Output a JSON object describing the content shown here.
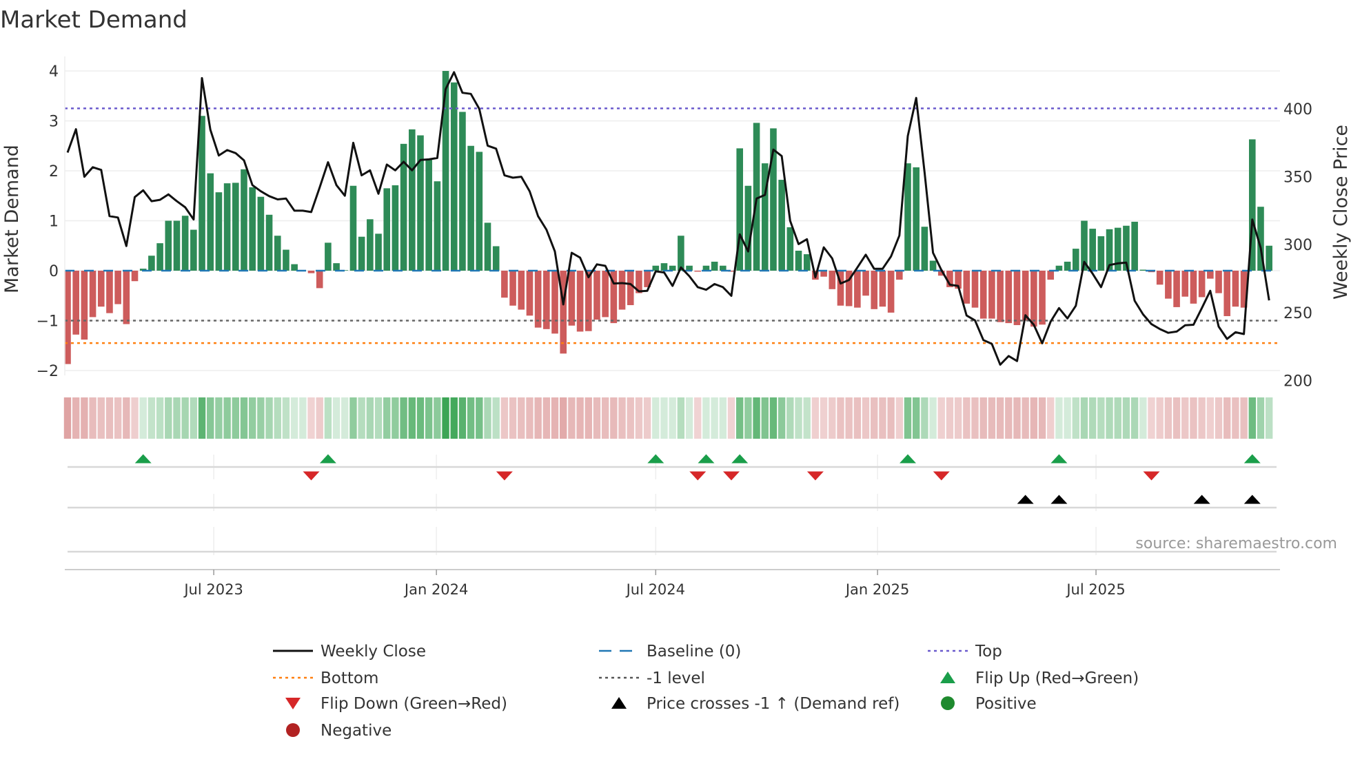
{
  "chart_data": {
    "type": "bar",
    "title": "Market Demand",
    "ylabel": "Market Demand",
    "y2label": "Weekly Close Price",
    "ylim": [
      -2.2,
      4.3
    ],
    "y2lim": [
      195,
      430
    ],
    "yticks": [
      -2,
      -1,
      0,
      1,
      2,
      3,
      4
    ],
    "y2ticks": [
      200,
      250,
      300,
      350,
      400
    ],
    "xticks": [
      "Jul 2023",
      "Jan 2024",
      "Jul 2024",
      "Jan 2025",
      "Jul 2025"
    ],
    "xtick_week_index": [
      17.4,
      43.9,
      70,
      96.4,
      122.4
    ],
    "grid": true,
    "levels": {
      "top": 3.25,
      "baseline": 0,
      "minus_one": -1,
      "bottom": -1.45
    },
    "demand": [
      -1.87,
      -1.28,
      -1.38,
      -0.93,
      -0.72,
      -0.85,
      -0.67,
      -1.07,
      -0.21,
      0.04,
      0.3,
      0.55,
      1.0,
      1.0,
      1.1,
      0.82,
      3.1,
      1.95,
      1.57,
      1.75,
      1.76,
      2.03,
      1.67,
      1.48,
      1.12,
      0.7,
      0.42,
      0.13,
      0.01,
      -0.05,
      -0.35,
      0.56,
      0.15,
      0.01,
      1.7,
      0.68,
      1.03,
      0.74,
      1.65,
      1.71,
      2.54,
      2.83,
      2.71,
      2.22,
      1.79,
      4.0,
      3.77,
      3.18,
      2.5,
      2.38,
      0.96,
      0.49,
      -0.54,
      -0.7,
      -0.78,
      -0.9,
      -1.14,
      -1.17,
      -1.26,
      -1.66,
      -1.1,
      -1.22,
      -1.21,
      -0.98,
      -0.93,
      -1.05,
      -0.78,
      -0.69,
      -0.45,
      -0.33,
      0.1,
      0.15,
      0.1,
      0.7,
      0.1,
      -0.02,
      0.1,
      0.18,
      0.1,
      -0.02,
      2.45,
      1.7,
      2.96,
      2.15,
      2.85,
      1.82,
      0.87,
      0.4,
      0.33,
      -0.18,
      -0.12,
      -0.37,
      -0.7,
      -0.71,
      -0.74,
      -0.5,
      -0.77,
      -0.72,
      -0.84,
      -0.18,
      2.15,
      2.07,
      0.88,
      0.2,
      -0.1,
      -0.33,
      -0.36,
      -0.66,
      -0.74,
      -0.96,
      -0.96,
      -1.03,
      -1.05,
      -1.09,
      -1.0,
      -1.12,
      -1.08,
      -0.18,
      0.1,
      0.18,
      0.44,
      1.0,
      0.84,
      0.69,
      0.83,
      0.86,
      0.9,
      0.98,
      0.02,
      -0.03,
      -0.28,
      -0.56,
      -0.73,
      -0.52,
      -0.66,
      -0.53,
      -0.16,
      -0.45,
      -0.91,
      -0.72,
      -0.74,
      2.63,
      1.28,
      0.5
    ],
    "weekly_close": [
      367.8,
      385,
      350,
      357,
      355,
      321,
      320,
      299,
      335,
      340,
      332,
      333,
      337,
      332,
      327.5,
      318.5,
      422.6,
      384.6,
      365.6,
      369.6,
      367.4,
      362,
      343.8,
      339.3,
      335.7,
      333.3,
      334,
      325,
      325,
      324,
      342,
      360.7,
      343.8,
      336,
      375,
      351,
      354.7,
      337.5,
      359,
      354.7,
      361,
      354.7,
      362.3,
      362.8,
      363.8,
      414.5,
      427,
      411.8,
      411,
      400,
      372.8,
      370.7,
      351,
      349.3,
      350,
      339.3,
      321,
      311,
      295,
      256,
      294,
      290.4,
      276,
      285.5,
      284.4,
      271.4,
      271.7,
      271,
      265.6,
      266,
      280.4,
      279.5,
      269.6,
      283.2,
      276.8,
      268.7,
      266.8,
      271,
      268.7,
      262.3,
      307.6,
      295,
      333.9,
      336.6,
      370,
      365.2,
      317.6,
      300.4,
      304,
      276,
      298,
      289.9,
      271.4,
      274,
      283.2,
      292.6,
      282.2,
      282.2,
      291.3,
      306.7,
      380,
      408,
      353,
      294,
      281.3,
      270.5,
      269.6,
      247.8,
      244.2,
      229.7,
      227,
      211.6,
      218,
      214.3,
      248,
      241,
      227.4,
      243.3,
      253.3,
      245.7,
      255,
      287.3,
      278.6,
      268.7,
      285,
      286.2,
      286.8,
      258.7,
      248.7,
      241.5,
      237.9,
      235.1,
      236,
      240.6,
      241,
      253.3,
      266,
      239.7,
      230.6,
      235.5,
      234.2,
      318.5,
      297.6,
      259
    ],
    "flip_up_index": [
      9,
      31,
      70,
      76,
      80,
      100,
      118,
      141
    ],
    "flip_down_index": [
      29,
      52,
      75,
      79,
      89,
      104,
      129
    ],
    "price_cross_index": [
      114,
      118,
      135,
      141
    ],
    "legend": [
      {
        "label": "Weekly Close",
        "kind": "line",
        "color": "#111111"
      },
      {
        "label": "Baseline (0)",
        "kind": "dash",
        "color": "#1f77b4"
      },
      {
        "label": "Top",
        "kind": "dot",
        "color": "#6a5acd"
      },
      {
        "label": "Bottom",
        "kind": "dot",
        "color": "#ff7f0e"
      },
      {
        "label": "-1 level",
        "kind": "dot",
        "color": "#555555"
      },
      {
        "label": "Flip Up (Red→Green)",
        "kind": "tri-up",
        "color": "#1a9e4a"
      },
      {
        "label": "Flip Down (Green→Red)",
        "kind": "tri-down",
        "color": "#d62728"
      },
      {
        "label": "Price crosses -1 ↑ (Demand ref)",
        "kind": "tri-up",
        "color": "#000000"
      },
      {
        "label": "Positive",
        "kind": "circle",
        "color": "#1e8a2e"
      },
      {
        "label": "Negative",
        "kind": "circle",
        "color": "#b22222"
      }
    ],
    "legend_position": "bottom",
    "colors": {
      "positive_bar": "#2e8b57",
      "negative_bar": "#cd5c5c",
      "price": "#111111"
    },
    "source": "source: sharemaestro.com"
  }
}
